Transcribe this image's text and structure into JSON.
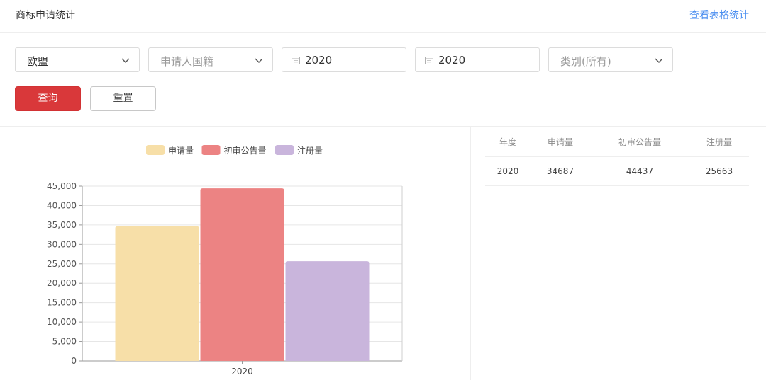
{
  "header": {
    "title": "商标申请统计",
    "table_link": "查看表格统计"
  },
  "filters": {
    "region": {
      "value": "欧盟",
      "icon": "chevron-down-icon"
    },
    "nationality": {
      "placeholder": "申请人国籍",
      "icon": "chevron-down-icon"
    },
    "start_year": {
      "value": "2020",
      "icon": "calendar-icon"
    },
    "end_year": {
      "value": "2020",
      "icon": "calendar-icon"
    },
    "category": {
      "placeholder": "类别(所有)",
      "icon": "chevron-down-icon"
    }
  },
  "buttons": {
    "query": "查询",
    "reset": "重置"
  },
  "colors": {
    "accent": "#d9383a",
    "link": "#4a8ef0",
    "series_apply": "#f7dfa8",
    "series_announce": "#ec8383",
    "series_register": "#c9b5dc"
  },
  "chart_data": {
    "type": "bar",
    "categories": [
      "2020"
    ],
    "series": [
      {
        "name": "申请量",
        "values": [
          34687
        ],
        "color": "#f7dfa8"
      },
      {
        "name": "初审公告量",
        "values": [
          44437
        ],
        "color": "#ec8383"
      },
      {
        "name": "注册量",
        "values": [
          25663
        ],
        "color": "#c9b5dc"
      }
    ],
    "ylim": [
      0,
      45000
    ],
    "yticks": [
      0,
      5000,
      10000,
      15000,
      20000,
      25000,
      30000,
      35000,
      40000,
      45000
    ],
    "ytick_labels": [
      "0",
      "5,000",
      "10,000",
      "15,000",
      "20,000",
      "25,000",
      "30,000",
      "35,000",
      "40,000",
      "45,000"
    ],
    "legend_position": "top-center",
    "grid": true
  },
  "table": {
    "headers": [
      "年度",
      "申请量",
      "初审公告量",
      "注册量"
    ],
    "rows": [
      [
        "2020",
        "34687",
        "44437",
        "25663"
      ]
    ]
  }
}
